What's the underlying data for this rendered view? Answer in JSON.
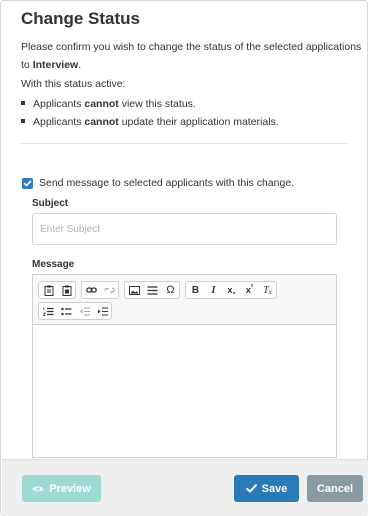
{
  "dialog": {
    "title": "Change Status",
    "confirm_line1": "Please confirm you wish to change the status of the selected applications",
    "confirm_line2_prefix": "to ",
    "confirm_line2_status": "Interview",
    "confirm_line2_suffix": ".",
    "status_active_line": "With this status active:",
    "bullets": [
      {
        "before": "Applicants ",
        "bold": "cannot",
        "after": " view this status."
      },
      {
        "before": "Applicants ",
        "bold": "cannot",
        "after": " update their application materials."
      }
    ]
  },
  "send_message": {
    "checked": true,
    "label": "Send message to selected applicants with this change."
  },
  "subject": {
    "label": "Subject",
    "placeholder": "Enter Subject",
    "value": ""
  },
  "message": {
    "label": "Message",
    "toolbar_icons": [
      "paste-text-icon",
      "paste-word-icon",
      "link-icon",
      "unlink-icon",
      "image-icon",
      "horizontal-line-icon",
      "special-char-icon",
      "bold-icon",
      "italic-icon",
      "subscript-icon",
      "superscript-icon",
      "remove-format-icon",
      "numbered-list-icon",
      "bulleted-list-icon",
      "outdent-icon",
      "indent-icon"
    ],
    "toolbar_text": {
      "special_char": "Ω",
      "bold": "B",
      "italic": "I",
      "subscript_base": "x",
      "subscript_sub": "₂",
      "superscript_base": "x",
      "superscript_sup": "²",
      "remove_format_base": "T",
      "remove_format_sub": "x"
    }
  },
  "footer": {
    "preview_label": "Preview",
    "save_label": "Save",
    "cancel_label": "Cancel"
  },
  "colors": {
    "primary": "#2a7ab8",
    "preview_disabled": "#9fd9d4",
    "cancel": "#8a9aa3",
    "checkbox": "#2f7bbd"
  }
}
